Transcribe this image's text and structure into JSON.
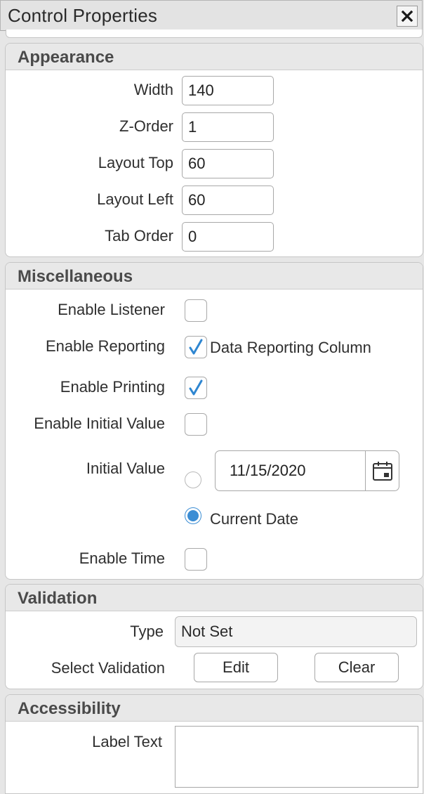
{
  "window": {
    "title": "Control Properties",
    "close_icon": "close-icon"
  },
  "appearance": {
    "heading": "Appearance",
    "fields": [
      {
        "label": "Width",
        "value": "140"
      },
      {
        "label": "Z-Order",
        "value": "1"
      },
      {
        "label": "Layout Top",
        "value": "60"
      },
      {
        "label": "Layout Left",
        "value": "60"
      },
      {
        "label": "Tab Order",
        "value": "0"
      }
    ]
  },
  "misc": {
    "heading": "Miscellaneous",
    "enable_listener": {
      "label": "Enable Listener",
      "checked": false
    },
    "enable_reporting": {
      "label": "Enable Reporting",
      "checked": true,
      "column_label": "Data Reporting Column"
    },
    "enable_printing": {
      "label": "Enable Printing",
      "checked": true
    },
    "enable_initial_value": {
      "label": "Enable Initial Value",
      "checked": false
    },
    "initial_value": {
      "label": "Initial Value",
      "date": "11/15/2020",
      "current_date_label": "Current Date",
      "selected": "current_date"
    },
    "enable_time": {
      "label": "Enable Time",
      "checked": false
    }
  },
  "validation": {
    "heading": "Validation",
    "type_label": "Type",
    "type_value": "Not Set",
    "select_label": "Select Validation",
    "edit_label": "Edit",
    "clear_label": "Clear"
  },
  "accessibility": {
    "heading": "Accessibility",
    "label_text_label": "Label Text",
    "label_text_value": ""
  },
  "colors": {
    "accent": "#3b8dd4",
    "header_bg": "#e8e8e8",
    "panel_border": "#c6c6c6"
  }
}
